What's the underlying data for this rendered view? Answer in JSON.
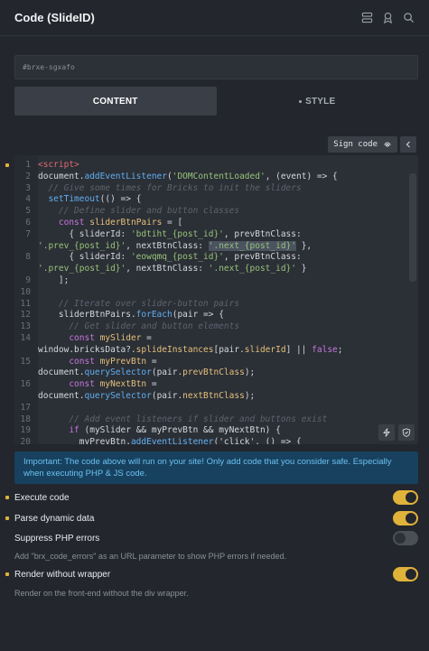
{
  "header": {
    "title": "Code (SlideID)",
    "icons": [
      "layers-icon",
      "pin-icon",
      "search-icon"
    ]
  },
  "element_id": {
    "value": "#brxe-sgxafo"
  },
  "tabs": [
    {
      "label": "CONTENT",
      "active": true
    },
    {
      "label": "STYLE",
      "active": false
    }
  ],
  "sign_code": {
    "label": "Sign code"
  },
  "code_lines": [
    {
      "n": "1",
      "tokens": [
        {
          "t": "<script>",
          "c": "tag"
        }
      ]
    },
    {
      "n": "2",
      "tokens": [
        {
          "t": "document.",
          "c": ""
        },
        {
          "t": "addEventListener",
          "c": "fn"
        },
        {
          "t": "(",
          "c": ""
        },
        {
          "t": "'DOMContentLoaded'",
          "c": "str"
        },
        {
          "t": ", (event) => {",
          "c": ""
        }
      ]
    },
    {
      "n": "3",
      "tokens": [
        {
          "t": "  // Give some times for Bricks to init the sliders",
          "c": "com"
        }
      ]
    },
    {
      "n": "4",
      "tokens": [
        {
          "t": "  ",
          "c": ""
        },
        {
          "t": "setTimeout",
          "c": "fn"
        },
        {
          "t": "(() => {",
          "c": ""
        }
      ]
    },
    {
      "n": "5",
      "tokens": [
        {
          "t": "    // Define slider and button classes",
          "c": "com"
        }
      ]
    },
    {
      "n": "6",
      "tokens": [
        {
          "t": "    ",
          "c": ""
        },
        {
          "t": "const ",
          "c": "kw"
        },
        {
          "t": "sliderBtnPairs",
          "c": "var"
        },
        {
          "t": " = [",
          "c": ""
        }
      ]
    },
    {
      "n": "7",
      "tokens": [
        {
          "t": "      { sliderId: ",
          "c": ""
        },
        {
          "t": "'bdtiht_{post_id}'",
          "c": "str"
        },
        {
          "t": ", prevBtnClass:",
          "c": ""
        }
      ]
    },
    {
      "n": "",
      "tokens": [
        {
          "t": "'.prev_{post_id}'",
          "c": "str"
        },
        {
          "t": ", nextBtnClass: ",
          "c": ""
        },
        {
          "t": "'.next_{post_id}'",
          "c": "hl"
        },
        {
          "t": " },",
          "c": ""
        }
      ]
    },
    {
      "n": "8",
      "tokens": [
        {
          "t": "      { sliderId: ",
          "c": ""
        },
        {
          "t": "'eowqmq_{post_id}'",
          "c": "str"
        },
        {
          "t": ", prevBtnClass:",
          "c": ""
        }
      ]
    },
    {
      "n": "",
      "tokens": [
        {
          "t": "'.prev_{post_id}'",
          "c": "str"
        },
        {
          "t": ", nextBtnClass: ",
          "c": ""
        },
        {
          "t": "'.next_{post_id}'",
          "c": "str"
        },
        {
          "t": " }",
          "c": ""
        }
      ]
    },
    {
      "n": "9",
      "tokens": [
        {
          "t": "    ];",
          "c": ""
        }
      ]
    },
    {
      "n": "10",
      "tokens": []
    },
    {
      "n": "11",
      "tokens": [
        {
          "t": "    // Iterate over slider-button pairs",
          "c": "com"
        }
      ]
    },
    {
      "n": "12",
      "tokens": [
        {
          "t": "    sliderBtnPairs.",
          "c": ""
        },
        {
          "t": "forEach",
          "c": "fn"
        },
        {
          "t": "(pair => {",
          "c": ""
        }
      ]
    },
    {
      "n": "13",
      "tokens": [
        {
          "t": "      // Get slider and button elements",
          "c": "com"
        }
      ]
    },
    {
      "n": "14",
      "tokens": [
        {
          "t": "      ",
          "c": ""
        },
        {
          "t": "const ",
          "c": "kw"
        },
        {
          "t": "mySlider",
          "c": "var"
        },
        {
          "t": " =",
          "c": ""
        }
      ]
    },
    {
      "n": "",
      "tokens": [
        {
          "t": "window.bricksData?.",
          "c": ""
        },
        {
          "t": "splideInstances",
          "c": "prop"
        },
        {
          "t": "[pair.",
          "c": ""
        },
        {
          "t": "sliderId",
          "c": "prop"
        },
        {
          "t": "] || ",
          "c": ""
        },
        {
          "t": "false",
          "c": "kw"
        },
        {
          "t": ";",
          "c": ""
        }
      ]
    },
    {
      "n": "15",
      "tokens": [
        {
          "t": "      ",
          "c": ""
        },
        {
          "t": "const ",
          "c": "kw"
        },
        {
          "t": "myPrevBtn",
          "c": "var"
        },
        {
          "t": " =",
          "c": ""
        }
      ]
    },
    {
      "n": "",
      "tokens": [
        {
          "t": "document.",
          "c": ""
        },
        {
          "t": "querySelector",
          "c": "fn"
        },
        {
          "t": "(pair.",
          "c": ""
        },
        {
          "t": "prevBtnClass",
          "c": "prop"
        },
        {
          "t": ");",
          "c": ""
        }
      ]
    },
    {
      "n": "16",
      "tokens": [
        {
          "t": "      ",
          "c": ""
        },
        {
          "t": "const ",
          "c": "kw"
        },
        {
          "t": "myNextBtn",
          "c": "var"
        },
        {
          "t": " =",
          "c": ""
        }
      ]
    },
    {
      "n": "",
      "tokens": [
        {
          "t": "document.",
          "c": ""
        },
        {
          "t": "querySelector",
          "c": "fn"
        },
        {
          "t": "(pair.",
          "c": ""
        },
        {
          "t": "nextBtnClass",
          "c": "prop"
        },
        {
          "t": ");",
          "c": ""
        }
      ]
    },
    {
      "n": "17",
      "tokens": []
    },
    {
      "n": "18",
      "tokens": [
        {
          "t": "      // Add event listeners if slider and buttons exist",
          "c": "com"
        }
      ]
    },
    {
      "n": "19",
      "tokens": [
        {
          "t": "      ",
          "c": ""
        },
        {
          "t": "if ",
          "c": "kw"
        },
        {
          "t": "(mySlider && myPrevBtn && myNextBtn) {",
          "c": ""
        }
      ]
    },
    {
      "n": "20",
      "tokens": [
        {
          "t": "        myPrevBtn.",
          "c": ""
        },
        {
          "t": "addEventListener",
          "c": "fn"
        },
        {
          "t": "('click', () => {",
          "c": ""
        }
      ]
    }
  ],
  "notice": "Important: The code above will run on your site! Only add code that you consider safe. Especially when executing PHP & JS code.",
  "settings": {
    "execute_code": {
      "label": "Execute code",
      "on": true
    },
    "parse_dynamic": {
      "label": "Parse dynamic data",
      "on": true
    },
    "suppress_php": {
      "label": "Suppress PHP errors",
      "on": false,
      "description": "Add \"brx_code_errors\" as an URL parameter to show PHP errors if needed."
    },
    "render_without_wrapper": {
      "label": "Render without wrapper",
      "on": true,
      "description": "Render on the front-end without the div wrapper."
    }
  },
  "colors": {
    "accent": "#e0b23a",
    "panel_bg": "#23262d",
    "notice_bg": "#17415e",
    "notice_text": "#6cc0f2"
  }
}
